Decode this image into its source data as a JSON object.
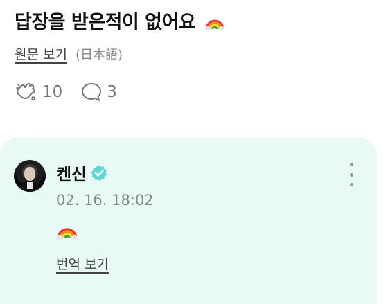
{
  "post": {
    "title": "답장을 받은적이 없어요",
    "original_link": "원문 보기",
    "original_lang": "(日本語)",
    "like_count": "10",
    "comment_count": "3"
  },
  "comment": {
    "author": "켄신",
    "verified": true,
    "timestamp": "02. 16. 18:02",
    "translate_link": "번역 보기"
  },
  "icons": {
    "like": "cheer-hand-icon",
    "comment": "speech-bubble-icon",
    "verified": "verified-badge-icon",
    "more": "more-vertical-icon",
    "emoji": "rainbow-emoji"
  },
  "colors": {
    "card_background": "#e9f9f6",
    "verified_badge": "#5fd6d0"
  }
}
